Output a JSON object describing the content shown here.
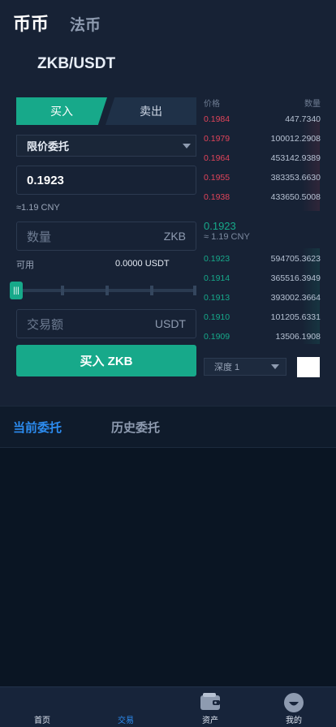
{
  "header": {
    "tab_active": "币币",
    "tab_other": "法币",
    "pair": "ZKB/USDT"
  },
  "trade_form": {
    "buy_tab": "买入",
    "sell_tab": "卖出",
    "order_type": "限价委托",
    "price_value": "0.1923",
    "price_cny": "≈1.19 CNY",
    "qty_placeholder": "数量",
    "qty_unit": "ZKB",
    "available_label": "可用",
    "available_value": "0.0000 USDT",
    "slider_percent": 0,
    "amount_placeholder": "交易额",
    "amount_unit": "USDT",
    "submit_label": "买入 ZKB"
  },
  "orderbook": {
    "price_header": "价格",
    "qty_header": "数量",
    "asks": [
      {
        "price": "0.1984",
        "qty": "447.7340"
      },
      {
        "price": "0.1979",
        "qty": "100012.2908"
      },
      {
        "price": "0.1964",
        "qty": "453142.9389"
      },
      {
        "price": "0.1955",
        "qty": "383353.6630"
      },
      {
        "price": "0.1938",
        "qty": "433650.5008"
      }
    ],
    "last_price": "0.1923",
    "last_cny": "≈ 1.19 CNY",
    "bids": [
      {
        "price": "0.1923",
        "qty": "594705.3623"
      },
      {
        "price": "0.1914",
        "qty": "365516.3949"
      },
      {
        "price": "0.1913",
        "qty": "393002.3664"
      },
      {
        "price": "0.1910",
        "qty": "101205.6331"
      },
      {
        "price": "0.1909",
        "qty": "13506.1908"
      }
    ],
    "depth_label": "深度 1",
    "ask_color": "#e0445a",
    "bid_color": "#17a98a"
  },
  "order_tabs": {
    "current": "当前委托",
    "history": "历史委托"
  },
  "bottom_nav": [
    {
      "label": "首页",
      "icon": "home-icon"
    },
    {
      "label": "交易",
      "icon": "trade-icon"
    },
    {
      "label": "资产",
      "icon": "wallet-icon"
    },
    {
      "label": "我的",
      "icon": "profile-icon"
    }
  ],
  "colors": {
    "accent_green": "#17a98a",
    "accent_blue": "#2c8cf0"
  }
}
